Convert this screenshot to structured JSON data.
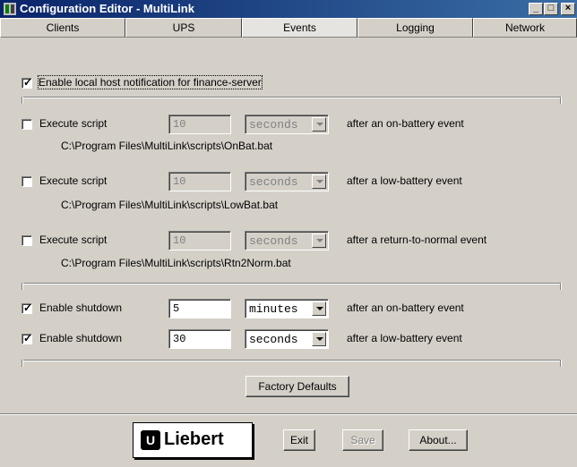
{
  "window": {
    "title": "Configuration Editor - MultiLink"
  },
  "tabs": [
    {
      "label": "Clients"
    },
    {
      "label": "UPS"
    },
    {
      "label": "Events",
      "selected": true
    },
    {
      "label": "Logging"
    },
    {
      "label": "Network"
    }
  ],
  "notification": {
    "label": "Enable local host notification for finance-server",
    "checked": true
  },
  "scripts": [
    {
      "label": "Execute script",
      "checked": false,
      "value": "10",
      "unit": "seconds",
      "after": "after an on-battery event",
      "path": "C:\\Program Files\\MultiLink\\scripts\\OnBat.bat"
    },
    {
      "label": "Execute script",
      "checked": false,
      "value": "10",
      "unit": "seconds",
      "after": "after a low-battery event",
      "path": "C:\\Program Files\\MultiLink\\scripts\\LowBat.bat"
    },
    {
      "label": "Execute script",
      "checked": false,
      "value": "10",
      "unit": "seconds",
      "after": "after a return-to-normal event",
      "path": "C:\\Program Files\\MultiLink\\scripts\\Rtn2Norm.bat"
    }
  ],
  "shutdowns": [
    {
      "label": "Enable shutdown",
      "checked": true,
      "value": "5",
      "unit": "minutes",
      "after": "after an on-battery event"
    },
    {
      "label": "Enable shutdown",
      "checked": true,
      "value": "30",
      "unit": "seconds",
      "after": "after a low-battery event"
    }
  ],
  "buttons": {
    "factory_defaults": "Factory Defaults",
    "exit": "Exit",
    "save": "Save",
    "about": "About..."
  },
  "logo": {
    "text": "Liebert",
    "mark": "U",
    "registered": "."
  },
  "colors": {
    "titlebar_start": "#0a246a",
    "titlebar_end": "#3a6ea5",
    "face": "#d4d0c8"
  }
}
